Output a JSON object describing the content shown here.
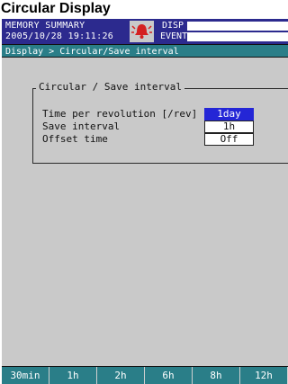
{
  "heading": "Circular Display",
  "status": {
    "mode_line": "MEMORY SUMMARY",
    "datetime": "2005/10/28 19:11:26",
    "disp_label": "DISP",
    "event_label": "EVENT",
    "alarm_icon": "alarm-bell-icon",
    "colors": {
      "status_bg": "#2c2a8e",
      "bar_bg": "#2a7e88",
      "selected": "#2426d6"
    }
  },
  "breadcrumb": "Display > Circular/Save interval",
  "panel": {
    "title": "Circular / Save interval",
    "rows": [
      {
        "label": "Time per revolution [/rev]",
        "value": "1day",
        "selected": true
      },
      {
        "label": "Save interval",
        "value": "1h",
        "selected": false
      },
      {
        "label": "Offset time",
        "value": "Off",
        "selected": false
      }
    ]
  },
  "softkeys": [
    "30min",
    "1h",
    "2h",
    "6h",
    "8h",
    "12h"
  ]
}
